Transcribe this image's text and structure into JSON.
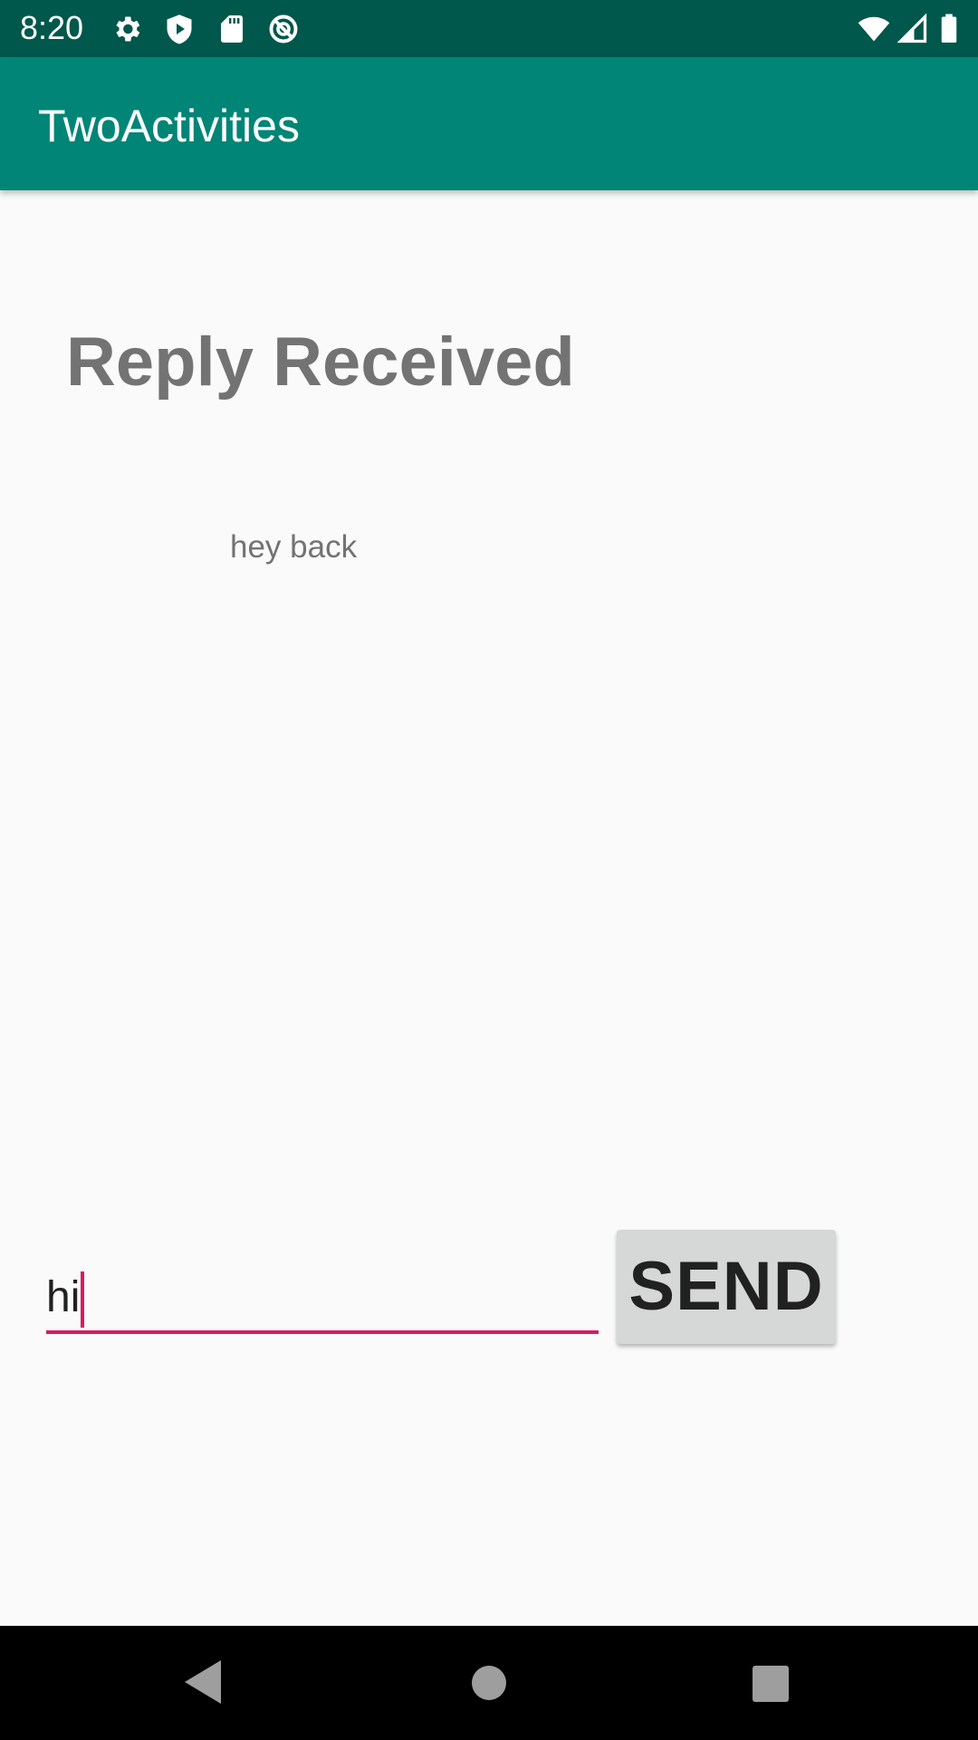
{
  "status_bar": {
    "time": "8:20",
    "icons_left": [
      "gear-icon",
      "play-protect-icon",
      "sd-card-icon",
      "no-sync-icon"
    ],
    "icons_right": [
      "wifi-icon",
      "cellular-signal-icon",
      "battery-icon"
    ]
  },
  "app_bar": {
    "title": "TwoActivities",
    "color": "#008577"
  },
  "main": {
    "reply_header": "Reply Received",
    "reply_message": "hey back"
  },
  "compose": {
    "input_value": "hi",
    "send_label": "SEND",
    "accent_color": "#d81b60"
  },
  "nav_bar": {
    "buttons": [
      "back-icon",
      "home-icon",
      "recents-icon"
    ]
  }
}
